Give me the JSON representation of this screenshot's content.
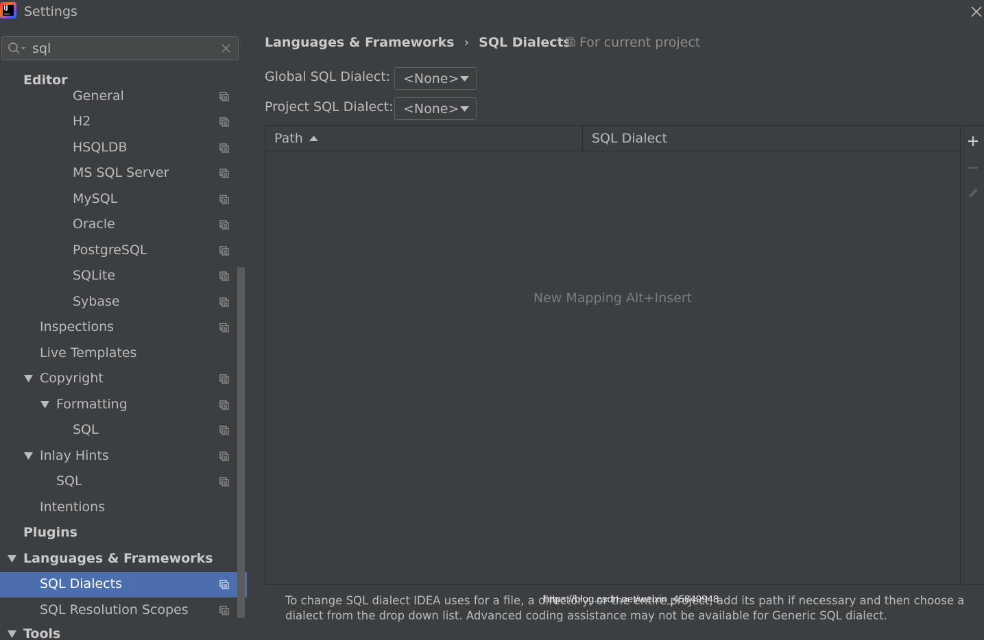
{
  "window": {
    "title": "Settings"
  },
  "search": {
    "value": "sql"
  },
  "tree": [
    {
      "label": "Editor",
      "bold": true,
      "has_proj_icon": false,
      "selected": false
    },
    {
      "label": "General",
      "bold": false,
      "has_proj_icon": true,
      "selected": false
    },
    {
      "label": "H2",
      "bold": false,
      "has_proj_icon": true,
      "selected": false
    },
    {
      "label": "HSQLDB",
      "bold": false,
      "has_proj_icon": true,
      "selected": false
    },
    {
      "label": "MS SQL Server",
      "bold": false,
      "has_proj_icon": true,
      "selected": false
    },
    {
      "label": "MySQL",
      "bold": false,
      "has_proj_icon": true,
      "selected": false
    },
    {
      "label": "Oracle",
      "bold": false,
      "has_proj_icon": true,
      "selected": false
    },
    {
      "label": "PostgreSQL",
      "bold": false,
      "has_proj_icon": true,
      "selected": false
    },
    {
      "label": "SQLite",
      "bold": false,
      "has_proj_icon": true,
      "selected": false
    },
    {
      "label": "Sybase",
      "bold": false,
      "has_proj_icon": true,
      "selected": false
    },
    {
      "label": "Inspections",
      "bold": false,
      "has_proj_icon": true,
      "selected": false
    },
    {
      "label": "Live Templates",
      "bold": false,
      "has_proj_icon": false,
      "selected": false
    },
    {
      "label": "Copyright",
      "bold": false,
      "has_proj_icon": true,
      "selected": false,
      "expanded": true
    },
    {
      "label": "Formatting",
      "bold": false,
      "has_proj_icon": true,
      "selected": false,
      "expanded": true
    },
    {
      "label": "SQL",
      "bold": false,
      "has_proj_icon": true,
      "selected": false
    },
    {
      "label": "Inlay Hints",
      "bold": false,
      "has_proj_icon": true,
      "selected": false,
      "expanded": true
    },
    {
      "label": "SQL",
      "bold": false,
      "has_proj_icon": true,
      "selected": false
    },
    {
      "label": "Intentions",
      "bold": false,
      "has_proj_icon": false,
      "selected": false
    },
    {
      "label": "Plugins",
      "bold": true,
      "has_proj_icon": false,
      "selected": false
    },
    {
      "label": "Languages & Frameworks",
      "bold": true,
      "has_proj_icon": false,
      "selected": false,
      "expanded": true
    },
    {
      "label": "SQL Dialects",
      "bold": false,
      "has_proj_icon": true,
      "selected": true
    },
    {
      "label": "SQL Resolution Scopes",
      "bold": false,
      "has_proj_icon": true,
      "selected": false
    },
    {
      "label": "Tools",
      "bold": true,
      "has_proj_icon": false,
      "selected": false,
      "expanded": true
    }
  ],
  "main": {
    "breadcrumb": {
      "parent": "Languages & Frameworks",
      "separator": "›",
      "current": "SQL Dialects"
    },
    "scope_label": "For current project",
    "global_dialect": {
      "label": "Global SQL Dialect:",
      "value": "<None>"
    },
    "project_dialect": {
      "label": "Project SQL Dialect:",
      "value": "<None>"
    },
    "table": {
      "columns": [
        "Path",
        "SQL Dialect"
      ],
      "sorted_by": "Path",
      "empty_text": "New Mapping Alt+Insert"
    },
    "toolbar": {
      "add_icon": "plus-icon",
      "remove_icon": "minus-icon",
      "edit_icon": "pencil-icon"
    },
    "help_text": "To change SQL dialect IDEA uses for a file, a directory, or the entire project, add its path if necessary and then choose a dialect from the drop down list. Advanced coding assistance may not be available for Generic SQL dialect."
  },
  "watermark": "https://blog.csdn.net/weixin_45849948",
  "colors": {
    "background": "#3c3f41",
    "selection": "#4b6eaf",
    "text": "#bbbbbb"
  }
}
